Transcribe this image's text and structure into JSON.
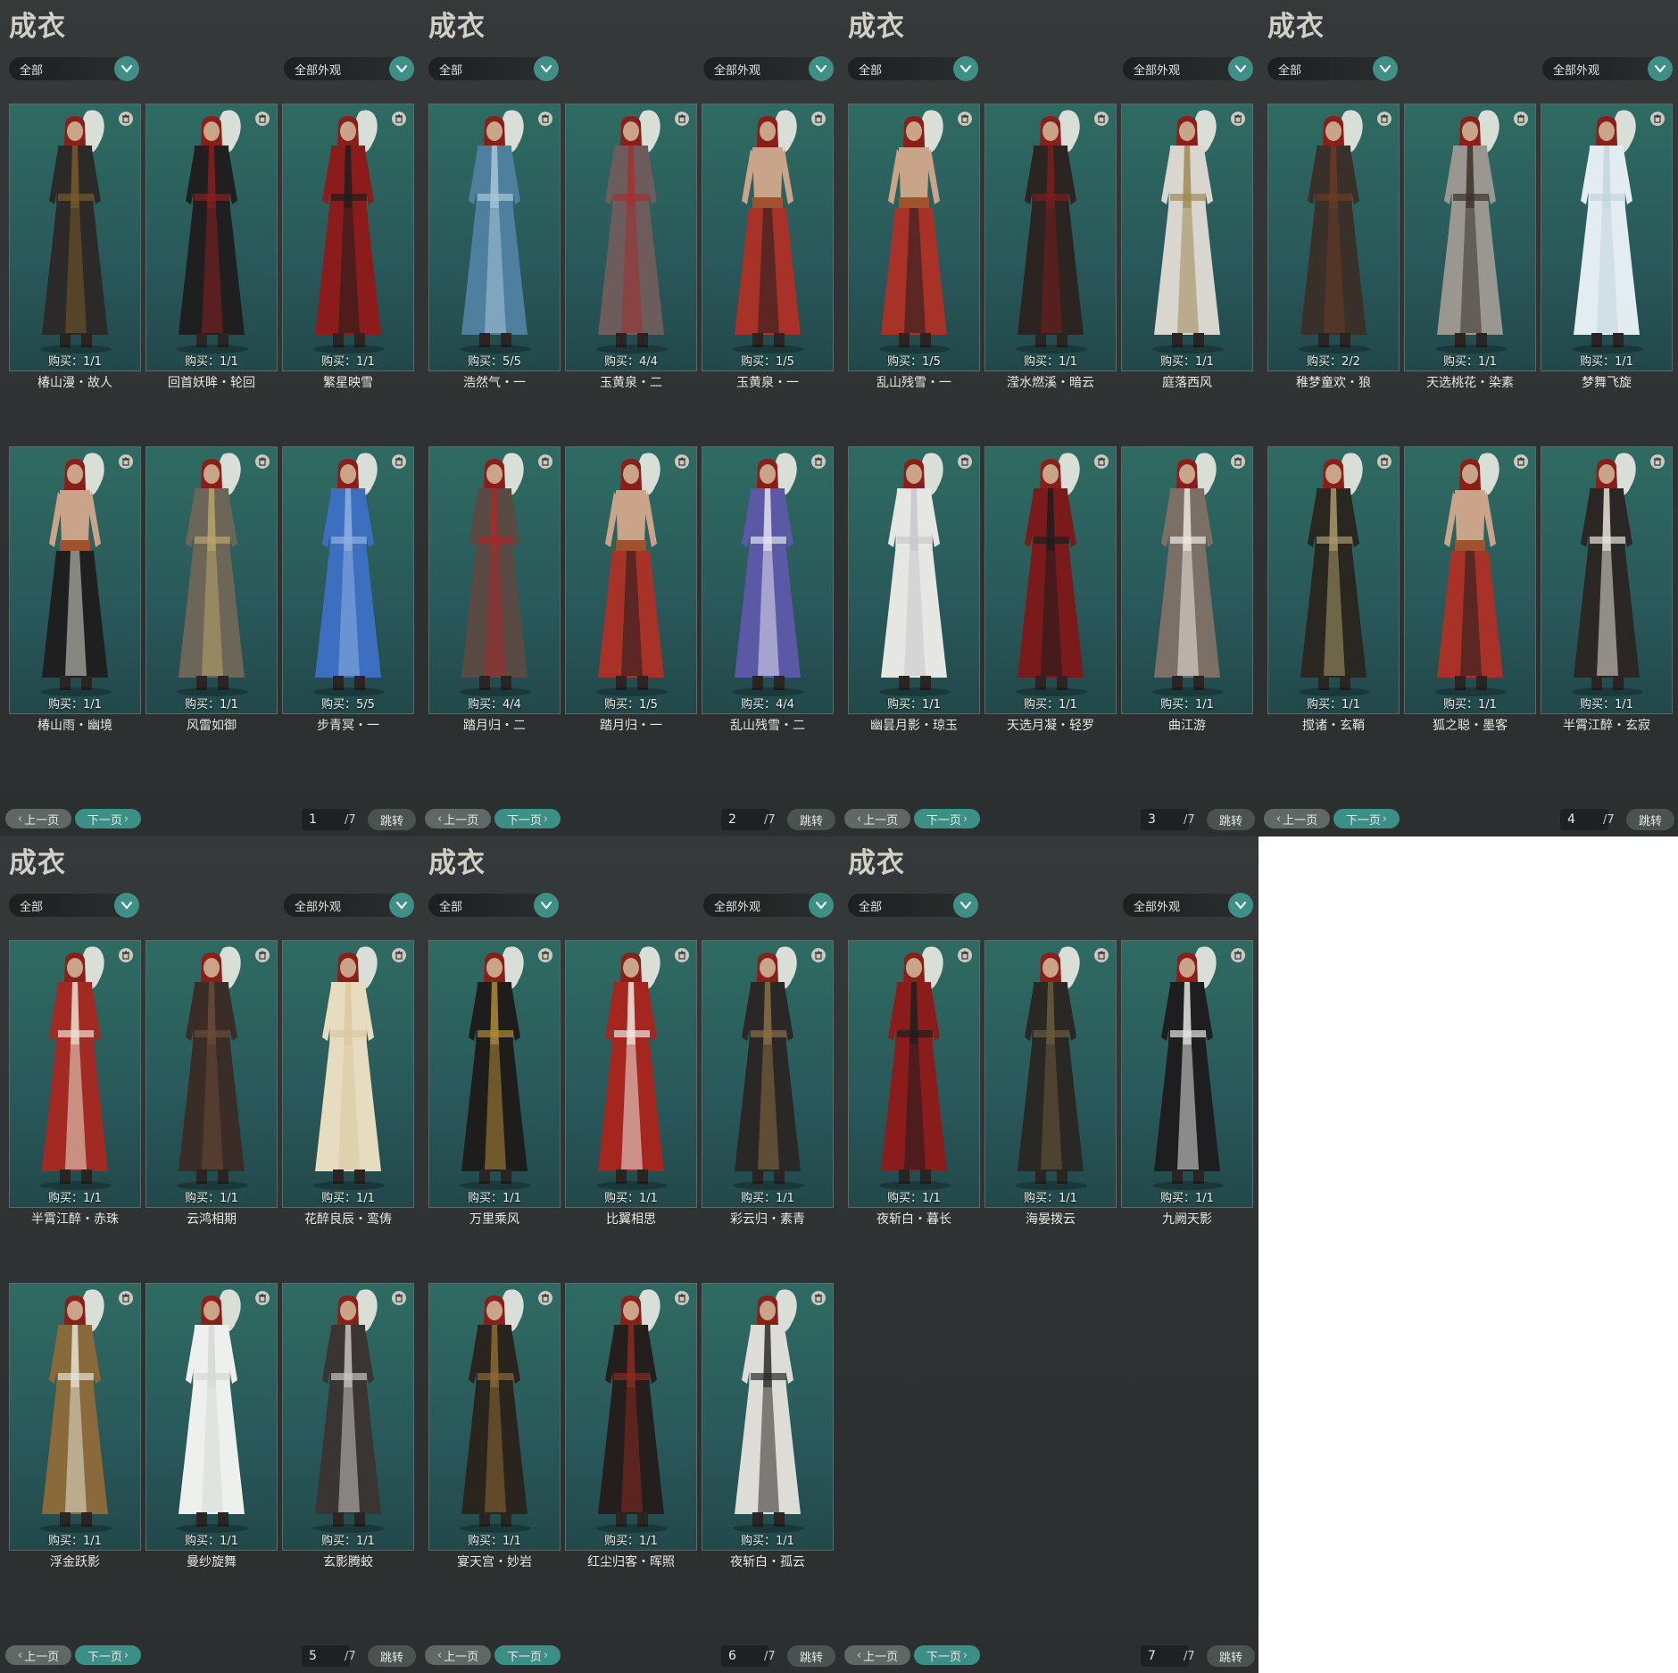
{
  "colors": {
    "panel_bg": "#2e3233",
    "card_bg": "#2f6b62",
    "accent": "#3c8f86",
    "text": "#e9e7de"
  },
  "icons": {
    "dropdown_arrow": "chevron-down-icon",
    "delete": "trash-icon",
    "prev": "chevron-left-icon",
    "next": "chevron-right-icon"
  },
  "panels": [
    {
      "title": "成衣",
      "filter_category": "全部",
      "filter_appearance": "全部外观",
      "prev_label": "上一页",
      "next_label": "下一页",
      "page": "1",
      "total": "/7",
      "jump_label": "跳转",
      "items": [
        {
          "name": "椿山漫・故人",
          "buy": "购买：1/1",
          "outfit": "#2b2a28",
          "accent": "#7a5a2a",
          "skin": "#c9a489",
          "bare": false
        },
        {
          "name": "回首妖眸・轮回",
          "buy": "购买：1/1",
          "outfit": "#1f1f20",
          "accent": "#8a1f1f",
          "skin": "#c9a489",
          "bare": false
        },
        {
          "name": "繁星映雪",
          "buy": "购买：1/1",
          "outfit": "#8c1c1c",
          "accent": "#1e1e1e",
          "skin": "#c9a489",
          "bare": false
        },
        {
          "name": "椿山雨・幽境",
          "buy": "购买：1/1",
          "outfit": "#1f1f1f",
          "accent": "#dcdad2",
          "skin": "#c9a489",
          "bare": true
        },
        {
          "name": "风雷如御",
          "buy": "购买：1/1",
          "outfit": "#6b6658",
          "accent": "#b9a46a",
          "skin": "#c9a489",
          "bare": false
        },
        {
          "name": "步青冥・一",
          "buy": "购买：5/5",
          "outfit": "#3d6fc0",
          "accent": "#8fb0e0",
          "skin": "#c9a489",
          "bare": false
        }
      ]
    },
    {
      "title": "成衣",
      "filter_category": "全部",
      "filter_appearance": "全部外观",
      "prev_label": "上一页",
      "next_label": "下一页",
      "page": "2",
      "total": "/7",
      "jump_label": "跳转",
      "items": [
        {
          "name": "浩然气・一",
          "buy": "购买：5/5",
          "outfit": "#4f7f9f",
          "accent": "#a8c6d6",
          "skin": "#c9a489",
          "bare": false
        },
        {
          "name": "玉黄泉・二",
          "buy": "购买：4/4",
          "outfit": "#6d5c5c",
          "accent": "#a23030",
          "skin": "#c9a489",
          "bare": false
        },
        {
          "name": "玉黄泉・一",
          "buy": "购买：1/5",
          "outfit": "#a83228",
          "accent": "#1d1d1d",
          "skin": "#c9a489",
          "bare": true
        },
        {
          "name": "踏月归・二",
          "buy": "购买：4/4",
          "outfit": "#5a4a44",
          "accent": "#a42a2a",
          "skin": "#c9a489",
          "bare": false
        },
        {
          "name": "踏月归・一",
          "buy": "购买：1/5",
          "outfit": "#a83228",
          "accent": "#1d1d1d",
          "skin": "#c9a489",
          "bare": true
        },
        {
          "name": "乱山残雪・二",
          "buy": "购买：4/4",
          "outfit": "#5b59a6",
          "accent": "#e4e2ee",
          "skin": "#c9a489",
          "bare": false
        }
      ]
    },
    {
      "title": "成衣",
      "filter_category": "全部",
      "filter_appearance": "全部外观",
      "prev_label": "上一页",
      "next_label": "下一页",
      "page": "3",
      "total": "/7",
      "jump_label": "跳转",
      "items": [
        {
          "name": "乱山残雪・一",
          "buy": "购买：1/5",
          "outfit": "#a83228",
          "accent": "#1d1d1d",
          "skin": "#c9a489",
          "bare": true
        },
        {
          "name": "滢水燃溪・暗云",
          "buy": "购买：1/1",
          "outfit": "#2c2420",
          "accent": "#7b1d1d",
          "skin": "#c9a489",
          "bare": false
        },
        {
          "name": "庭落西风",
          "buy": "购买：1/1",
          "outfit": "#d8d6cf",
          "accent": "#a08a55",
          "skin": "#c9a489",
          "bare": false
        },
        {
          "name": "幽昙月影・琼玉",
          "buy": "购买：1/1",
          "outfit": "#e6e6e2",
          "accent": "#c4c8cc",
          "skin": "#c9a489",
          "bare": false
        },
        {
          "name": "天选月凝・轻罗",
          "buy": "购买：1/1",
          "outfit": "#7a1a1a",
          "accent": "#1e1e1e",
          "skin": "#c9a489",
          "bare": false
        },
        {
          "name": "曲江游",
          "buy": "购买：1/1",
          "outfit": "#7c6f66",
          "accent": "#ebe8e2",
          "skin": "#c9a489",
          "bare": false
        }
      ]
    },
    {
      "title": "成衣",
      "filter_category": "全部",
      "filter_appearance": "全部外观",
      "prev_label": "上一页",
      "next_label": "下一页",
      "page": "4",
      "total": "/7",
      "jump_label": "跳转",
      "items": [
        {
          "name": "稚梦童欢・狼",
          "buy": "购买：2/2",
          "outfit": "#3a302a",
          "accent": "#6b3b24",
          "skin": "#c9a489",
          "bare": false
        },
        {
          "name": "天选桃花・染素",
          "buy": "购买：1/1",
          "outfit": "#9a9690",
          "accent": "#3b3028",
          "skin": "#c9a489",
          "bare": false
        },
        {
          "name": "梦舞飞旋",
          "buy": "购买：1/1",
          "outfit": "#e3ecf0",
          "accent": "#c2d6de",
          "skin": "#c9a489",
          "bare": false
        },
        {
          "name": "搅诸・玄鞘",
          "buy": "购买：1/1",
          "outfit": "#2a2620",
          "accent": "#a89a6a",
          "skin": "#c9a489",
          "bare": false
        },
        {
          "name": "狐之聪・墨客",
          "buy": "购买：1/1",
          "outfit": "#a83228",
          "accent": "#1d1d1d",
          "skin": "#c9a489",
          "bare": true
        },
        {
          "name": "半霄江醉・玄寂",
          "buy": "购买：1/1",
          "outfit": "#2a2724",
          "accent": "#e8e4d8",
          "skin": "#c9a489",
          "bare": false
        }
      ]
    },
    {
      "title": "成衣",
      "filter_category": "全部",
      "filter_appearance": "全部外观",
      "prev_label": "上一页",
      "next_label": "下一页",
      "page": "5",
      "total": "/7",
      "jump_label": "跳转",
      "items": [
        {
          "name": "半霄江醉・赤珠",
          "buy": "购买：1/1",
          "outfit": "#a22a22",
          "accent": "#eae2d0",
          "skin": "#c9a489",
          "bare": false
        },
        {
          "name": "云鸿相期",
          "buy": "购买：1/1",
          "outfit": "#3a2c26",
          "accent": "#6a4a3a",
          "skin": "#c9a489",
          "bare": false
        },
        {
          "name": "花醉良辰・鸾俦",
          "buy": "购买：1/1",
          "outfit": "#e8dcc0",
          "accent": "#d9c89e",
          "skin": "#c9a489",
          "bare": false
        },
        {
          "name": "浮金跃影",
          "buy": "购买：1/1",
          "outfit": "#8a6a3a",
          "accent": "#e6e2d6",
          "skin": "#c9a489",
          "bare": false
        },
        {
          "name": "曼纱旋舞",
          "buy": "购买：1/1",
          "outfit": "#eef0ee",
          "accent": "#d6d8d6",
          "skin": "#c9a489",
          "bare": false
        },
        {
          "name": "玄影腾蛟",
          "buy": "购买：1/1",
          "outfit": "#3a3432",
          "accent": "#c8c6c0",
          "skin": "#c9a489",
          "bare": false
        }
      ]
    },
    {
      "title": "成衣",
      "filter_category": "全部",
      "filter_appearance": "全部外观",
      "prev_label": "上一页",
      "next_label": "下一页",
      "page": "6",
      "total": "/7",
      "jump_label": "跳转",
      "items": [
        {
          "name": "万里乘风",
          "buy": "购买：1/1",
          "outfit": "#1f1d1c",
          "accent": "#b08a3a",
          "skin": "#c9a489",
          "bare": false
        },
        {
          "name": "比翼相思",
          "buy": "购买：1/1",
          "outfit": "#a5261e",
          "accent": "#eeeae2",
          "skin": "#c9a489",
          "bare": false
        },
        {
          "name": "彩云归・素青",
          "buy": "购买：1/1",
          "outfit": "#2a2826",
          "accent": "#8a6e44",
          "skin": "#c9a489",
          "bare": false
        },
        {
          "name": "宴天宫・妙岩",
          "buy": "购买：1/1",
          "outfit": "#2a241e",
          "accent": "#8c6a34",
          "skin": "#c9a489",
          "bare": false
        },
        {
          "name": "红尘归客・晖照",
          "buy": "购买：1/1",
          "outfit": "#241e1c",
          "accent": "#8a2a22",
          "skin": "#c9a489",
          "bare": false
        },
        {
          "name": "夜斩白・孤云",
          "buy": "购买：1/1",
          "outfit": "#dedcd6",
          "accent": "#2a2a2a",
          "skin": "#c9a489",
          "bare": false
        }
      ]
    },
    {
      "title": "成衣",
      "filter_category": "全部",
      "filter_appearance": "全部外观",
      "prev_label": "上一页",
      "next_label": "下一页",
      "page": "7",
      "total": "/7",
      "jump_label": "跳转",
      "items": [
        {
          "name": "夜斩白・暮长",
          "buy": "购买：1/1",
          "outfit": "#8a1c1c",
          "accent": "#1e1e1e",
          "skin": "#c9a489",
          "bare": false
        },
        {
          "name": "海晏拨云",
          "buy": "购买：1/1",
          "outfit": "#2a2824",
          "accent": "#6a5a3a",
          "skin": "#c9a489",
          "bare": false
        },
        {
          "name": "九阙天影",
          "buy": "购买：1/1",
          "outfit": "#1e1e20",
          "accent": "#e6e6e2",
          "skin": "#c9a489",
          "bare": false
        }
      ]
    }
  ]
}
